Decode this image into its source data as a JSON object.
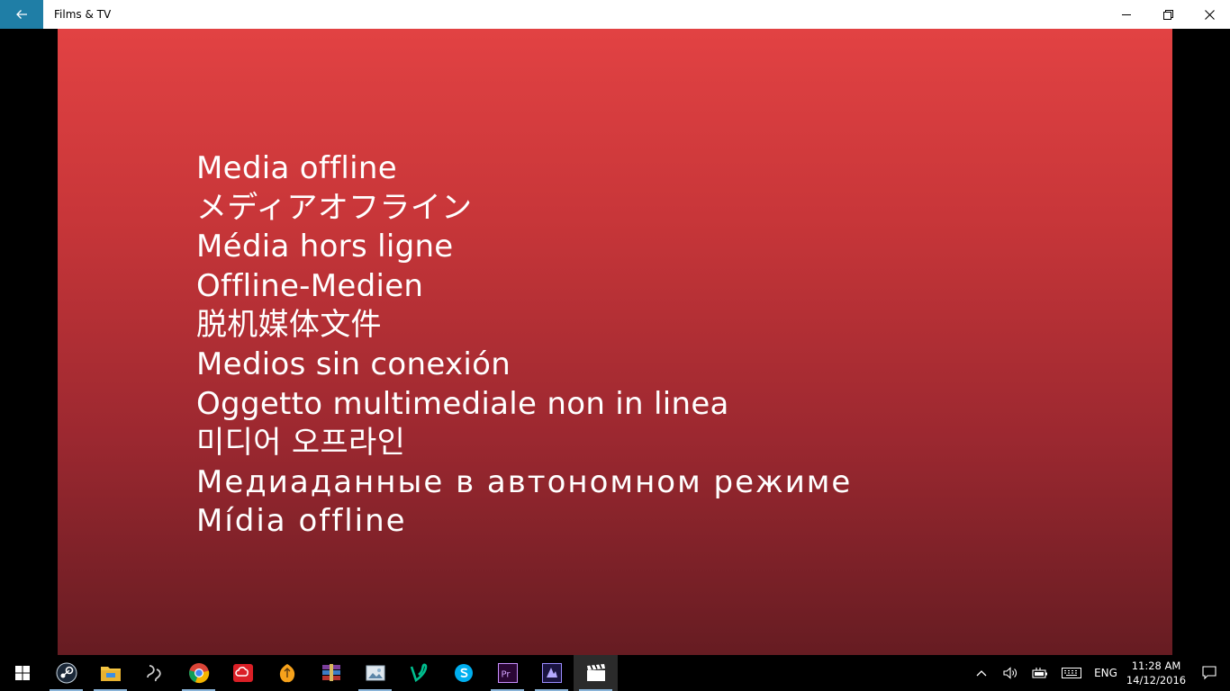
{
  "window": {
    "title": "Films & TV"
  },
  "video": {
    "lines": [
      "Media offline",
      "メディアオフライン",
      "Média hors ligne",
      "Offline-Medien",
      "脱机媒体文件",
      "Medios sin conexión",
      "Oggetto multimediale non in linea",
      "미디어 오프라인",
      "Медиаданные в автономном режиме",
      "Mídia offline"
    ]
  },
  "taskbar": {
    "apps": [
      {
        "name": "steam-icon",
        "running": true
      },
      {
        "name": "file-explorer-icon",
        "running": true
      },
      {
        "name": "obs-icon",
        "running": false
      },
      {
        "name": "chrome-icon",
        "running": true
      },
      {
        "name": "creative-cloud-icon",
        "running": false
      },
      {
        "name": "fl-studio-icon",
        "running": false
      },
      {
        "name": "winrar-icon",
        "running": false
      },
      {
        "name": "photos-viewer-icon",
        "running": true
      },
      {
        "name": "vine-icon",
        "running": false
      },
      {
        "name": "skype-icon",
        "running": false
      },
      {
        "name": "premiere-pro-icon",
        "running": true
      },
      {
        "name": "media-encoder-icon",
        "running": true
      },
      {
        "name": "films-tv-icon",
        "running": true
      }
    ],
    "tray": {
      "language": "ENG",
      "time": "11:28 AM",
      "date": "14/12/2016"
    }
  }
}
